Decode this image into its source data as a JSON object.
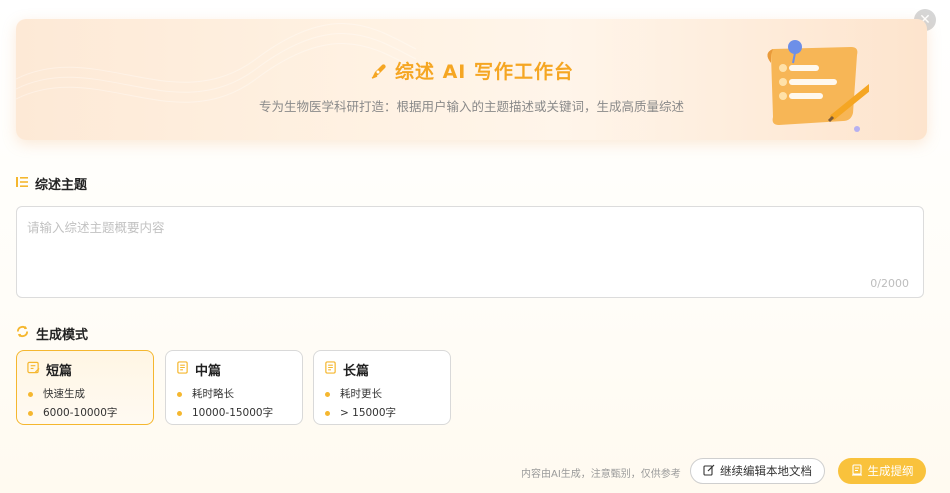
{
  "dialog": {
    "close_icon": "close-icon"
  },
  "banner": {
    "title": "综述 AI 写作工作台",
    "subtitle": "专为生物医学科研打造：根据用户输入的主题描述或关键词，生成高质量综述",
    "title_color": "#f5a623"
  },
  "topic": {
    "label": "综述主题",
    "placeholder": "请输入综述主题概要内容",
    "value": "",
    "counter": "0/2000"
  },
  "mode": {
    "label": "生成模式",
    "options": [
      {
        "title": "短篇",
        "bullets": [
          "快速生成",
          "6000-10000字"
        ],
        "selected": true
      },
      {
        "title": "中篇",
        "bullets": [
          "耗时略长",
          "10000-15000字"
        ],
        "selected": false
      },
      {
        "title": "长篇",
        "bullets": [
          "耗时更长",
          "> 15000字"
        ],
        "selected": false
      }
    ]
  },
  "footer": {
    "disclaimer": "内容由AI生成，注意甄别，仅供参考",
    "continue_label": "继续编辑本地文档",
    "generate_label": "生成提纲"
  },
  "colors": {
    "accent": "#f5b72f",
    "button": "#f9c23c"
  }
}
